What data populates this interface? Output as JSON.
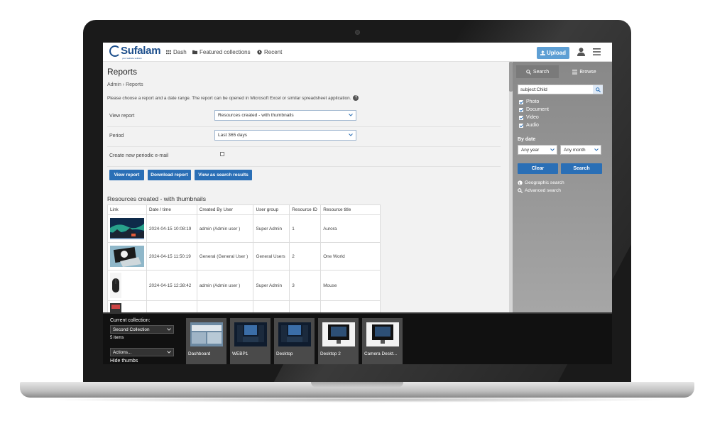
{
  "header": {
    "logo_text": "Sufalam",
    "logo_tagline": "your website solution",
    "nav": [
      {
        "label": "Dash",
        "icon": "grid-icon"
      },
      {
        "label": "Featured collections",
        "icon": "folder-icon"
      },
      {
        "label": "Recent",
        "icon": "clock-icon"
      }
    ],
    "upload_label": "Upload"
  },
  "main": {
    "title": "Reports",
    "breadcrumb": {
      "root": "Admin",
      "current": "Reports"
    },
    "intro": "Please choose a report and a date range. The report can be opened in Microsoft Excel or similar spreadsheet application.",
    "form": {
      "view_report_label": "View report",
      "view_report_value": "Resources created - with thumbnails",
      "period_label": "Period",
      "period_value": "Last 365 days",
      "periodic_email_label": "Create new periodic e-mail"
    },
    "buttons": {
      "view_report": "View report",
      "download_report": "Download report",
      "view_search_results": "View as search results"
    },
    "results_title": "Resources created - with thumbnails",
    "table": {
      "headers": [
        "Link",
        "Date / time",
        "Created By User",
        "User group",
        "Resource ID",
        "Resource title"
      ],
      "rows": [
        {
          "thumb": "aurora",
          "datetime": "2024-04-15 10:08:19",
          "user": "admin (Admin user )",
          "group": "Super Admin",
          "id": "1",
          "title": "Aurora"
        },
        {
          "thumb": "one-world",
          "datetime": "2024-04-15 11:50:19",
          "user": "General (General User )",
          "group": "General Users",
          "id": "2",
          "title": "One World"
        },
        {
          "thumb": "mouse",
          "datetime": "2024-04-15 12:38:42",
          "user": "admin (Admin user )",
          "group": "Super Admin",
          "id": "3",
          "title": "Mouse"
        }
      ]
    }
  },
  "search_panel": {
    "tab_search": "Search",
    "tab_browse": "Browse",
    "query": "subject:Child",
    "types": [
      "Photo",
      "Document",
      "Video",
      "Audio"
    ],
    "by_date_label": "By date",
    "year_value": "Any year",
    "month_value": "Any month",
    "clear_label": "Clear",
    "search_label": "Search",
    "geo_link": "Geographic search",
    "advanced_link": "Advanced search"
  },
  "collection_bar": {
    "current_label": "Current collection:",
    "collection_name": "Second Collection",
    "count": "5 items",
    "actions_label": "Actions...",
    "hide_thumbs": "Hide thumbs",
    "items": [
      "Dashboard",
      "WEBP1",
      "Desktop",
      "Desktop 2",
      "Camera Deskt..."
    ]
  },
  "colors": {
    "brand": "#1d4f8c",
    "primary_button": "#2a6fb6",
    "upload_button": "#5e9fd4"
  }
}
